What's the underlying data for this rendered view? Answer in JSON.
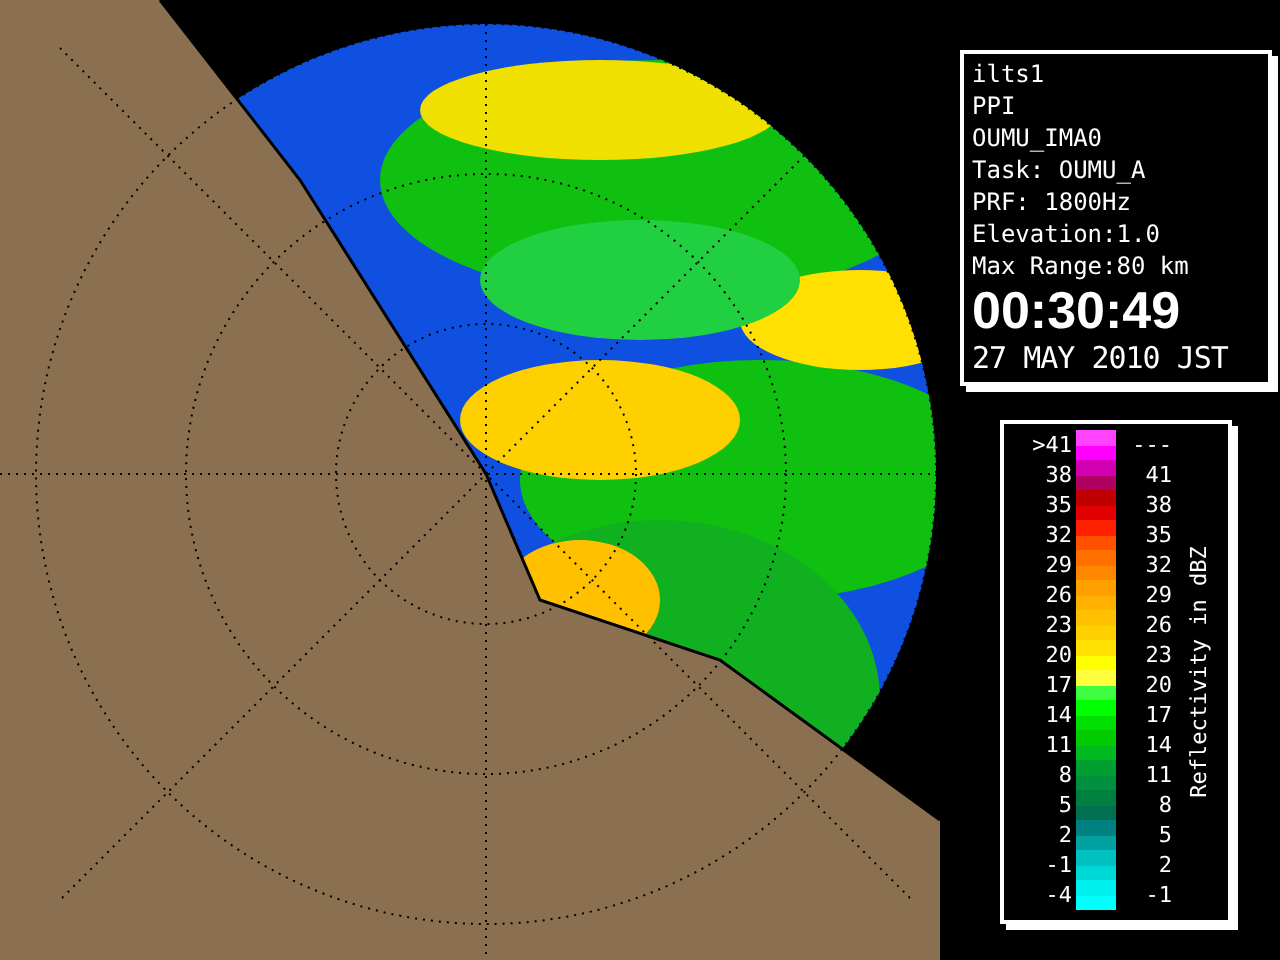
{
  "info": {
    "lines": [
      "ilts1",
      "PPI",
      "OUMU_IMA0",
      "Task: OUMU_A",
      "PRF: 1800Hz",
      "Elevation:1.0",
      "Max Range:80 km"
    ],
    "time": "00:30:49",
    "date": "27 MAY 2010 JST"
  },
  "legend": {
    "title": "Reflectivity in dBZ",
    "rows": [
      {
        "low": ">41",
        "high": "---",
        "bands": [
          {
            "color": "#ff44ff"
          },
          {
            "color": "#ff00ff"
          }
        ]
      },
      {
        "low": "38",
        "high": "41",
        "bands": [
          {
            "color": "#d000b0"
          },
          {
            "color": "#b00060"
          }
        ]
      },
      {
        "low": "35",
        "high": "38",
        "bands": [
          {
            "color": "#c00000"
          },
          {
            "color": "#e00000"
          }
        ]
      },
      {
        "low": "32",
        "high": "35",
        "bands": [
          {
            "color": "#ff2000"
          },
          {
            "color": "#ff5000"
          }
        ]
      },
      {
        "low": "29",
        "high": "32",
        "bands": [
          {
            "color": "#ff7000"
          },
          {
            "color": "#ff8800"
          }
        ]
      },
      {
        "low": "26",
        "high": "29",
        "bands": [
          {
            "color": "#ffa000"
          },
          {
            "color": "#ffb000"
          }
        ]
      },
      {
        "low": "23",
        "high": "26",
        "bands": [
          {
            "color": "#ffc000"
          },
          {
            "color": "#ffd000"
          }
        ]
      },
      {
        "low": "20",
        "high": "23",
        "bands": [
          {
            "color": "#ffe000"
          },
          {
            "color": "#ffff00"
          }
        ]
      },
      {
        "low": "17",
        "high": "20",
        "bands": [
          {
            "color": "#ffff40"
          },
          {
            "color": "#40ff40"
          }
        ]
      },
      {
        "low": "14",
        "high": "17",
        "bands": [
          {
            "color": "#00ff00"
          },
          {
            "color": "#00e000"
          }
        ]
      },
      {
        "low": "11",
        "high": "14",
        "bands": [
          {
            "color": "#00cc00"
          },
          {
            "color": "#00bb20"
          }
        ]
      },
      {
        "low": "8",
        "high": "11",
        "bands": [
          {
            "color": "#00a030"
          },
          {
            "color": "#009040"
          }
        ]
      },
      {
        "low": "5",
        "high": "8",
        "bands": [
          {
            "color": "#008040"
          },
          {
            "color": "#007050"
          }
        ]
      },
      {
        "low": "2",
        "high": "5",
        "bands": [
          {
            "color": "#008080"
          },
          {
            "color": "#00a0a0"
          }
        ]
      },
      {
        "low": "-1",
        "high": "2",
        "bands": [
          {
            "color": "#00c0c0"
          },
          {
            "color": "#00d8d8"
          }
        ]
      },
      {
        "low": "-4",
        "high": "-1",
        "bands": [
          {
            "color": "#00f0f0"
          },
          {
            "color": "#00ffff"
          }
        ]
      }
    ]
  }
}
